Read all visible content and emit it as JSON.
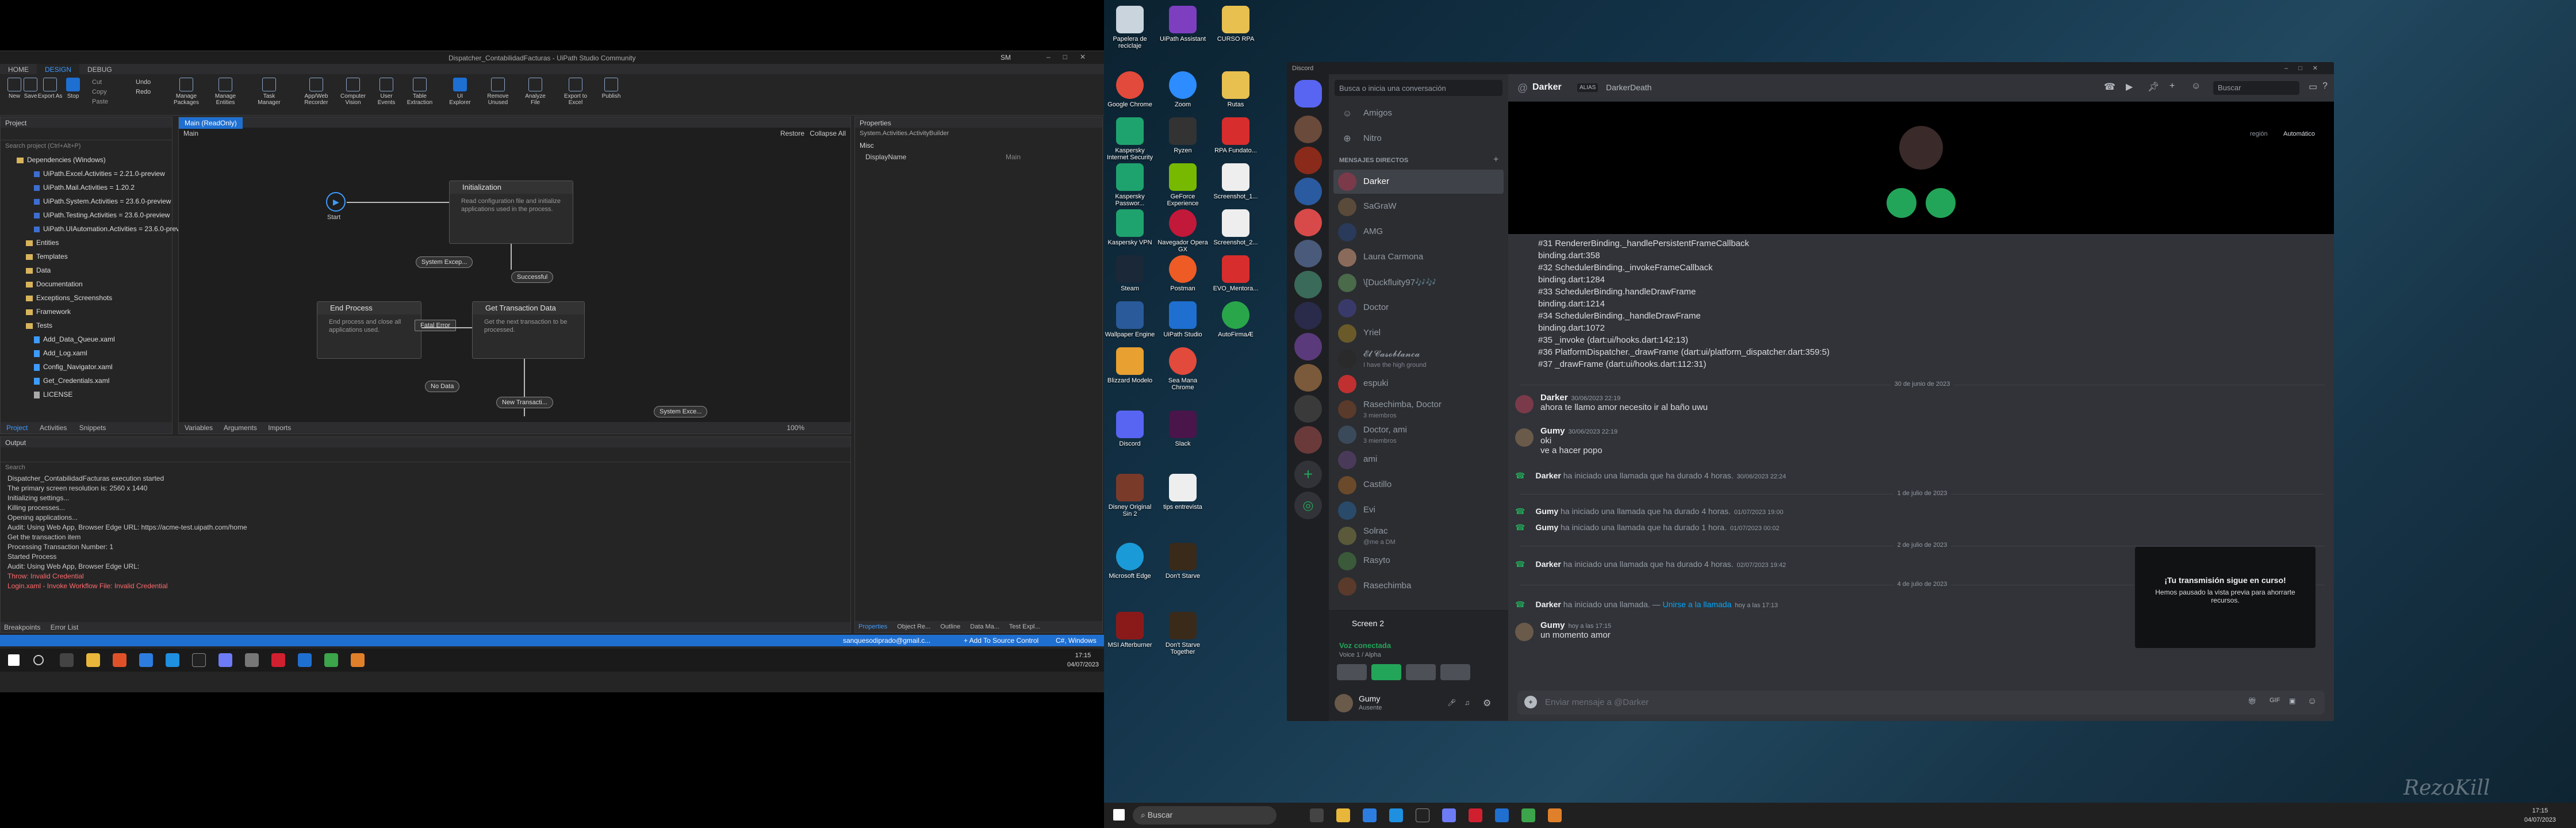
{
  "uipath": {
    "window_title": "Dispatcher_ContabilidadFacturas - UiPath Studio Community",
    "tabs": [
      "HOME",
      "DESIGN",
      "DEBUG"
    ],
    "user_initials": "SM",
    "ribbon": {
      "new": "New",
      "save": "Save",
      "export": "Export As",
      "stop": "Stop",
      "cut": "Cut",
      "copy": "Copy",
      "paste": "Paste",
      "undo": "Undo",
      "redo": "Redo",
      "manage_packages": "Manage Packages",
      "manage_entities": "Manage Entities",
      "task_manager": "Task Manager",
      "app_web_recorder": "App/Web Recorder",
      "computer_vision": "Computer Vision",
      "user_events": "User Events",
      "table_extraction": "Table Extraction",
      "ui_explorer": "UI Explorer",
      "remove_unused": "Remove Unused",
      "analyze_file": "Analyze File",
      "export_to_excel": "Export to Excel",
      "publish": "Publish"
    },
    "project_panel": {
      "title": "Project",
      "search_placeholder": "Search project (Ctrl+Alt+P)",
      "items": [
        "Dependencies (Windows)",
        "UiPath.Excel.Activities = 2.21.0-preview",
        "UiPath.Mail.Activities = 1.20.2",
        "UiPath.System.Activities = 23.6.0-preview",
        "UiPath.Testing.Activities = 23.6.0-preview",
        "UiPath.UIAutomation.Activities = 23.6.0-preview",
        "Entities",
        "Templates",
        "Data",
        "Documentation",
        "Exceptions_Screenshots",
        "Framework",
        "Tests",
        "Add_Data_Queue.xaml",
        "Add_Log.xaml",
        "Config_Navigator.xaml",
        "Get_Credentials.xaml",
        "LICENSE"
      ],
      "bottom_tabs": [
        "Project",
        "Activities",
        "Snippets"
      ]
    },
    "designer": {
      "tab": "Main (ReadOnly)",
      "breadcrumb": "Main",
      "restore": "Restore",
      "collapse_all": "Collapse All",
      "start": "Start",
      "initialization": {
        "title": "Initialization",
        "desc": "Read configuration file and initialize applications used in the process."
      },
      "end_process": {
        "title": "End Process",
        "desc": "End process and close all applications used."
      },
      "get_transaction": {
        "title": "Get Transaction Data",
        "desc": "Get the next transaction to be processed."
      },
      "labels": {
        "system_exception_1": "System Excep...",
        "successful": "Successful",
        "fatal_error": "Fatal Error",
        "no_data": "No Data",
        "new_transaction": "New Transacti...",
        "system_exception_2": "System Exce..."
      },
      "bottom_tabs": [
        "Variables",
        "Arguments",
        "Imports"
      ],
      "zoom": "100%"
    },
    "properties": {
      "title": "Properties",
      "subtitle": "System.Activities.ActivityBuilder",
      "section": "Misc",
      "display_name_label": "DisplayName",
      "display_name_value": "Main",
      "bottom_tabs": [
        "Properties",
        "Object Re...",
        "Outline",
        "Data Ma...",
        "Test Expl..."
      ]
    },
    "output": {
      "title": "Output",
      "search_placeholder": "Search",
      "lines": [
        "Dispatcher_ContabilidadFacturas execution started",
        "The primary screen resolution is: 2560 x 1440",
        "Initializing settings...",
        "Killing processes...",
        "Opening applications...",
        "Audit: Using Web App, Browser Edge URL: https://acme-test.uipath.com/home",
        "Get the transaction item",
        "Processing Transaction Number: 1",
        "Started Process",
        "Audit: Using Web App, Browser Edge URL:",
        "Throw: Invalid Credential",
        "Login.xaml - Invoke Workflow File: Invalid Credential"
      ],
      "bottom_tabs": [
        "Breakpoints",
        "Error List"
      ]
    },
    "status": {
      "account": "sanquesodiprado@gmail.c...",
      "source_control": "+ Add To Source Control",
      "target": "C#, Windows"
    }
  },
  "left_taskbar": {
    "time": "17:15",
    "date": "04/07/2023"
  },
  "desktop_icons": [
    "Papelera de reciclaje",
    "UiPath Assistant",
    "CURSO RPA",
    "Google Chrome",
    "Zoom",
    "Rutas",
    "Kaspersky Internet Security",
    "Ryzen",
    "RPA Fundato...",
    "Kaspersky Passwor...",
    "GeForce Experience",
    "Screenshot_1...",
    "Kaspersky VPN",
    "Navegador Opera GX",
    "Screenshot_2...",
    "Steam",
    "Postman",
    "EVO_Mentora...",
    "Wallpaper Engine",
    "UiPath Studio",
    "AutoFirmaÆ",
    "Blizzard Modelo",
    "Sea Mana Chrome",
    "Discord",
    "Slack",
    "Disney Original Sin 2",
    "tips entrevista",
    "Microsoft Edge",
    "Don't Starve",
    "MSI Afterburner",
    "Don't Starve Together"
  ],
  "discord": {
    "app_name": "Discord",
    "search_dm": "Busca o inicia una conversación",
    "friends": "Amigos",
    "nitro": "Nitro",
    "dm_header": "MENSAJES DIRECTOS",
    "dms": [
      {
        "name": "Darker",
        "sub": ""
      },
      {
        "name": "SaGraW",
        "sub": ""
      },
      {
        "name": "AMG",
        "sub": ""
      },
      {
        "name": "Laura Carmona",
        "sub": ""
      },
      {
        "name": "\\[Duckfluity97🎶🎶",
        "sub": ""
      },
      {
        "name": "Doctor",
        "sub": ""
      },
      {
        "name": "Yriel",
        "sub": ""
      },
      {
        "name": "𝓔𝓵 𝓒𝓪𝓼𝓸𝓫𝓵𝓪𝓷𝓬𝓪",
        "sub": "I have the high ground"
      },
      {
        "name": "espuki",
        "sub": ""
      },
      {
        "name": "Rasechimba, Doctor",
        "sub": "3 miembros"
      },
      {
        "name": "Doctor, ami",
        "sub": "3 miembros"
      },
      {
        "name": "ami",
        "sub": ""
      },
      {
        "name": "Castillo",
        "sub": ""
      },
      {
        "name": "Evi",
        "sub": ""
      },
      {
        "name": "Solrac",
        "sub": "@me a DM"
      },
      {
        "name": "Rasyto",
        "sub": ""
      },
      {
        "name": "Rasechimba",
        "sub": ""
      }
    ],
    "voice": {
      "channel": "Screen 2",
      "status": "Voz conectada",
      "sub": "Voice 1 / Alpha"
    },
    "user": {
      "name": "Gumy",
      "status": "Ausente"
    },
    "header": {
      "name": "Darker",
      "alias_tag": "ALIAS",
      "alias": "DarkerDeath",
      "search": "Buscar",
      "region_label": "región",
      "region_value": "Automático"
    },
    "code_lines": [
      "#31    RendererBinding._handlePersistentFrameCallback",
      "binding.dart:358",
      "#32    SchedulerBinding._invokeFrameCallback",
      "binding.dart:1284",
      "#33    SchedulerBinding.handleDrawFrame",
      "binding.dart:1214",
      "#34    SchedulerBinding._handleDrawFrame",
      "binding.dart:1072",
      "#35    _invoke (dart:ui/hooks.dart:142:13)",
      "#36    PlatformDispatcher._drawFrame (dart:ui/platform_dispatcher.dart:359:5)",
      "#37    _drawFrame (dart:ui/hooks.dart:112:31)"
    ],
    "divider1": "30 de junio de 2023",
    "msg1": {
      "author": "Darker",
      "time": "30/06/2023 22:19",
      "text": "ahora te llamo amor necesito ir al baño uwu"
    },
    "msg2": {
      "author": "Gumy",
      "time": "30/06/2023 22:19",
      "line1": "oki",
      "line2": "ve a hacer popo"
    },
    "call1": {
      "author": "Darker",
      "text": "ha iniciado una llamada que ha durado 4 horas.",
      "time": "30/06/2023 22:24"
    },
    "divider2": "1 de julio de 2023",
    "call2": {
      "author": "Gumy",
      "text": "ha iniciado una llamada que ha durado 4 horas.",
      "time": "01/07/2023 19:00"
    },
    "call3": {
      "author": "Gumy",
      "text": "ha iniciado una llamada que ha durado 1 hora.",
      "time": "01/07/2023 00:02"
    },
    "divider3": "2 de julio de 2023",
    "call4": {
      "author": "Darker",
      "text": "ha iniciado una llamada que ha durado 4 horas.",
      "time": "02/07/2023 19:42"
    },
    "divider4": "4 de julio de 2023",
    "call5": {
      "author": "Darker",
      "text": "ha iniciado una llamada.",
      "link": "Unirse a la llamada",
      "time": "hoy a las 17:13"
    },
    "msg3": {
      "author": "Gumy",
      "time": "hoy a las 17:15",
      "text": "un momento amor"
    },
    "stream_box": {
      "title": "¡Tu transmisión sigue en curso!",
      "desc": "Hemos pausado la vista previa para ahorrarte recursos."
    },
    "input_placeholder": "Enviar mensaje a @Darker"
  },
  "right_taskbar": {
    "search": "Buscar",
    "time": "17:15",
    "date": "04/07/2023"
  },
  "watermark": "RezoKill"
}
